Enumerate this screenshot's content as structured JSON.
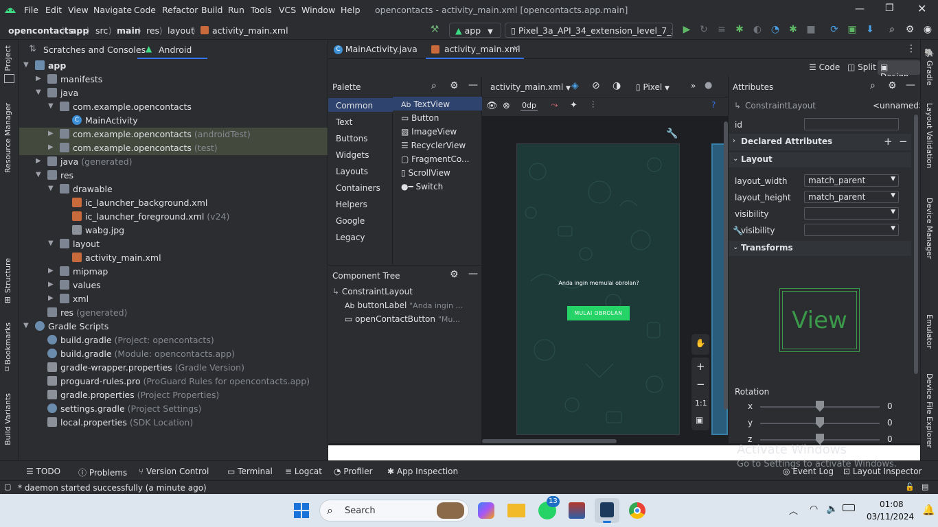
{
  "menu": {
    "items": [
      "File",
      "Edit",
      "View",
      "Navigate",
      "Code",
      "Refactor",
      "Build",
      "Run",
      "Tools",
      "VCS",
      "Window",
      "Help"
    ],
    "title": "opencontacts - activity_main.xml [opencontacts.app.main]"
  },
  "breadcrumb": [
    "opencontacts",
    "app",
    "src",
    "main",
    "res",
    "layout",
    "activity_main.xml"
  ],
  "toolbar": {
    "config": "app",
    "device": "Pixel_3a_API_34_extension_level_7_x86..."
  },
  "leftstrip": {
    "project": "Project",
    "resource_manager": "Resource Manager",
    "structure": "Structure",
    "bookmarks": "Bookmarks",
    "build_variants": "Build Variants"
  },
  "project_tabs": {
    "scratches": "Scratches and Consoles",
    "android": "Android"
  },
  "tree": [
    {
      "label": "app",
      "hint": ""
    },
    {
      "label": "manifests",
      "hint": ""
    },
    {
      "label": "java",
      "hint": ""
    },
    {
      "label": "com.example.opencontacts",
      "hint": ""
    },
    {
      "label": "MainActivity",
      "hint": ""
    },
    {
      "label": "com.example.opencontacts",
      "hint": "(androidTest)"
    },
    {
      "label": "com.example.opencontacts",
      "hint": "(test)"
    },
    {
      "label": "java",
      "hint": "(generated)"
    },
    {
      "label": "res",
      "hint": ""
    },
    {
      "label": "drawable",
      "hint": ""
    },
    {
      "label": "ic_launcher_background.xml",
      "hint": ""
    },
    {
      "label": "ic_launcher_foreground.xml",
      "hint": "(v24)"
    },
    {
      "label": "wabg.jpg",
      "hint": ""
    },
    {
      "label": "layout",
      "hint": ""
    },
    {
      "label": "activity_main.xml",
      "hint": ""
    },
    {
      "label": "mipmap",
      "hint": ""
    },
    {
      "label": "values",
      "hint": ""
    },
    {
      "label": "xml",
      "hint": ""
    },
    {
      "label": "res",
      "hint": "(generated)"
    },
    {
      "label": "Gradle Scripts",
      "hint": ""
    },
    {
      "label": "build.gradle",
      "hint": "(Project: opencontacts)"
    },
    {
      "label": "build.gradle",
      "hint": "(Module: opencontacts.app)"
    },
    {
      "label": "gradle-wrapper.properties",
      "hint": "(Gradle Version)"
    },
    {
      "label": "proguard-rules.pro",
      "hint": "(ProGuard Rules for opencontacts.app)"
    },
    {
      "label": "gradle.properties",
      "hint": "(Project Properties)"
    },
    {
      "label": "settings.gradle",
      "hint": "(Project Settings)"
    },
    {
      "label": "local.properties",
      "hint": "(SDK Location)"
    }
  ],
  "editor_tabs": [
    "MainActivity.java",
    "activity_main.xml"
  ],
  "view_modes": {
    "code": "Code",
    "split": "Split",
    "design": "Design"
  },
  "palette": {
    "title": "Palette",
    "categories": [
      "Common",
      "Text",
      "Buttons",
      "Widgets",
      "Layouts",
      "Containers",
      "Helpers",
      "Google",
      "Legacy"
    ],
    "widgets": [
      "TextView",
      "Button",
      "ImageView",
      "RecyclerView",
      "FragmentCo...",
      "ScrollView",
      "Switch"
    ]
  },
  "component_tree": {
    "title": "Component Tree",
    "root": "ConstraintLayout",
    "children": [
      {
        "label": "buttonLabel",
        "hint": "\"Anda ingin ..."
      },
      {
        "label": "openContactButton",
        "hint": "\"Mu..."
      }
    ]
  },
  "design_toolbar": {
    "file": "activity_main.xml",
    "device": "Pixel",
    "margin": "0dp"
  },
  "phone": {
    "prompt": "Anda ingin memulai obrolan?",
    "button": "MULAI OBROLAN",
    "button_color": "#25d366",
    "bg_color": "#1d3a38"
  },
  "attributes": {
    "title": "Attributes",
    "component": "ConstraintLayout",
    "component_id": "<unnamed>",
    "id_label": "id",
    "declared": "Declared Attributes",
    "layout": "Layout",
    "rows": [
      {
        "label": "layout_width",
        "value": "match_parent"
      },
      {
        "label": "layout_height",
        "value": "match_parent"
      },
      {
        "label": "visibility",
        "value": ""
      },
      {
        "label": "visibility",
        "value": ""
      }
    ],
    "transforms": "Transforms",
    "view_text": "View",
    "rotation": "Rotation",
    "rot": [
      {
        "axis": "x",
        "value": "0"
      },
      {
        "axis": "y",
        "value": "0"
      },
      {
        "axis": "z",
        "value": "0"
      }
    ]
  },
  "rightstrip": [
    "Gradle",
    "Layout Validation",
    "Device Manager",
    "Emulator",
    "Device File Explorer"
  ],
  "bottom_tools": [
    "TODO",
    "Problems",
    "Version Control",
    "Terminal",
    "Logcat",
    "Profiler",
    "App Inspection",
    "Event Log",
    "Layout Inspector"
  ],
  "watermark": {
    "line1": "Activate Windows",
    "line2": "Go to Settings to activate Windows."
  },
  "status": "* daemon started successfully (a minute ago)",
  "taskbar": {
    "search": "Search",
    "badge": "13",
    "time": "01:08",
    "date": "03/11/2024"
  }
}
